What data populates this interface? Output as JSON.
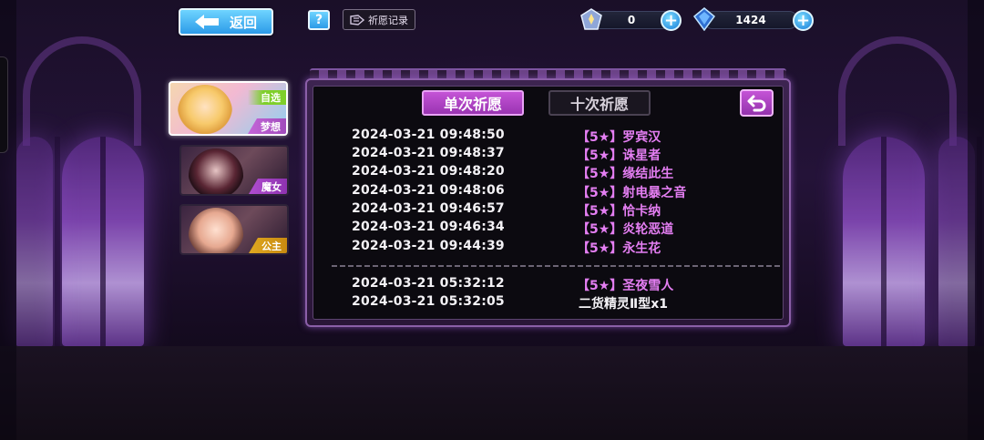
{
  "topbar": {
    "back_label": "返回",
    "help_label": "?",
    "record_label": "祈愿记录",
    "currency1_value": "0",
    "currency2_value": "1424",
    "plus_label": "+"
  },
  "banners": [
    {
      "tag": "梦想",
      "top_tag": "自选"
    },
    {
      "tag": "魔女"
    },
    {
      "tag": "公主"
    }
  ],
  "tabs": {
    "single": "单次祈愿",
    "ten": "十次祈愿"
  },
  "records": [
    {
      "time": "2024-03-21 09:48:50",
      "item": "【5★】罗宾汉"
    },
    {
      "time": "2024-03-21 09:48:37",
      "item": "【5★】诛星者"
    },
    {
      "time": "2024-03-21 09:48:20",
      "item": "【5★】缘结此生"
    },
    {
      "time": "2024-03-21 09:48:06",
      "item": "【5★】射电暴之音"
    },
    {
      "time": "2024-03-21 09:46:57",
      "item": "【5★】恰卡纳"
    },
    {
      "time": "2024-03-21 09:46:34",
      "item": "【5★】炎轮恶道"
    },
    {
      "time": "2024-03-21 09:44:39",
      "item": "【5★】永生花"
    },
    {
      "time": "2024-03-21 05:32:12",
      "item": "【5★】圣夜雪人"
    },
    {
      "time": "2024-03-21 05:32:05",
      "item": "二货精灵Ⅱ型x1"
    }
  ],
  "colors": {
    "accent_purple": "#c454d6",
    "record_item": "#e47ef2",
    "button_blue": "#2c9be8"
  }
}
